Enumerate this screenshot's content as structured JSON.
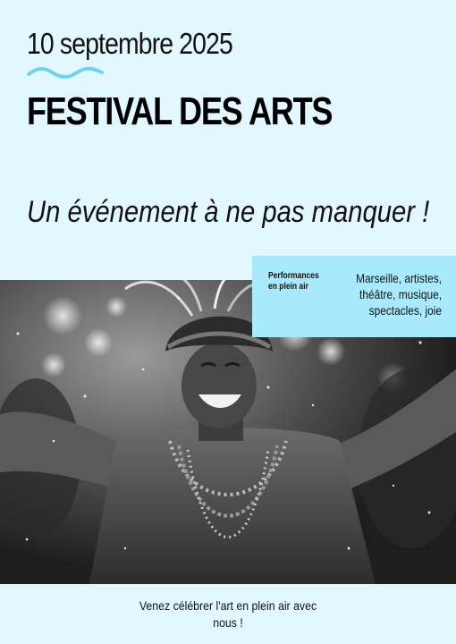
{
  "poster": {
    "date": "10 septembre 2025",
    "title": "FESTIVAL DES ARTS",
    "tagline": "Un événement à ne pas manquer !",
    "info": {
      "label": "Performances en plein air",
      "keywords": "Marseille, artistes, théâtre, musique, spectacles, joie"
    },
    "footer": "Venez célébrer l'art en plein air avec nous !"
  },
  "colors": {
    "background": "#e3f8fe",
    "accent_box": "#a8e9fc",
    "wave": "#6fd3f0"
  },
  "icons": [
    "wave-decoration-icon"
  ]
}
